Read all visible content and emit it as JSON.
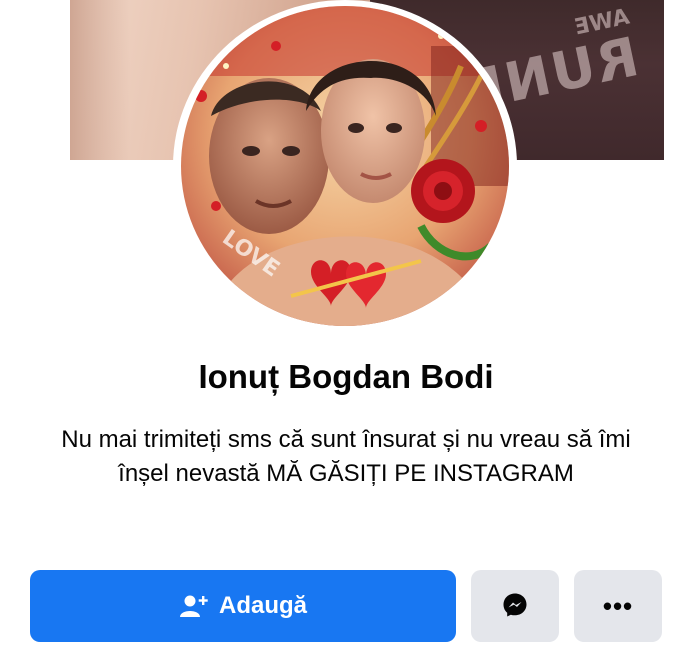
{
  "profile": {
    "name": "Ionuț Bogdan Bodi",
    "bio": "Nu mai trimiteți sms că sunt însurat și nu vreau să îmi înșel nevastă MĂ GĂSIȚI PE INSTAGRAM"
  },
  "cover": {
    "shirt_text_big": "RUNM",
    "shirt_text_small": "AWE"
  },
  "avatar": {
    "overlay_text": "LOVE"
  },
  "actions": {
    "add_label": "Adaugă",
    "add_icon": "add-friend-icon",
    "messenger_icon": "messenger-icon",
    "more_icon": "more-dots-icon",
    "more_glyph": "•••"
  },
  "colors": {
    "primary": "#1877f2",
    "secondary_button": "#e4e6eb",
    "text": "#050505"
  }
}
